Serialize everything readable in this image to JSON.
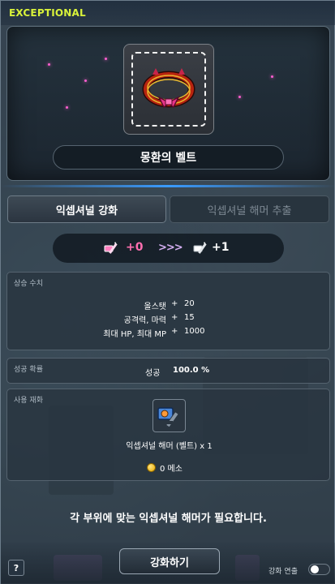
{
  "header": {
    "grade": "EXCEPTIONAL"
  },
  "item": {
    "name": "몽환의 벨트",
    "icon": "belt-icon"
  },
  "tabs": [
    {
      "label": "익셉셔널 강화",
      "active": true
    },
    {
      "label": "익셉셔널 해머 추출",
      "active": false
    }
  ],
  "level": {
    "current": "+0",
    "arrows": ">>>",
    "next": "+1",
    "icon": "exceptional-hammer-icon"
  },
  "stats": {
    "title": "상승 수치",
    "rows": [
      {
        "name": "올스탯",
        "sign": "+",
        "value": "20"
      },
      {
        "name": "공격력, 마력",
        "sign": "+",
        "value": "15"
      },
      {
        "name": "최대 HP, 최대 MP",
        "sign": "+",
        "value": "1000"
      }
    ]
  },
  "success": {
    "title": "성공 확률",
    "label": "성공",
    "value": "100.0 %"
  },
  "material": {
    "title": "사용 재화",
    "name": "익셉셔널 해머 (벨트) x 1",
    "meso": "0 메소",
    "icon": "hammer-material-icon"
  },
  "notice": "각 부위에 맞는 익셉셔널 해머가 필요합니다.",
  "buttons": {
    "help": "?",
    "enhance": "강화하기"
  },
  "auto": {
    "label": "강화 연출",
    "enabled": false
  },
  "colors": {
    "grade": "#d9f23a",
    "current_level": "#ff6fb0",
    "accent": "#3a9bff"
  }
}
